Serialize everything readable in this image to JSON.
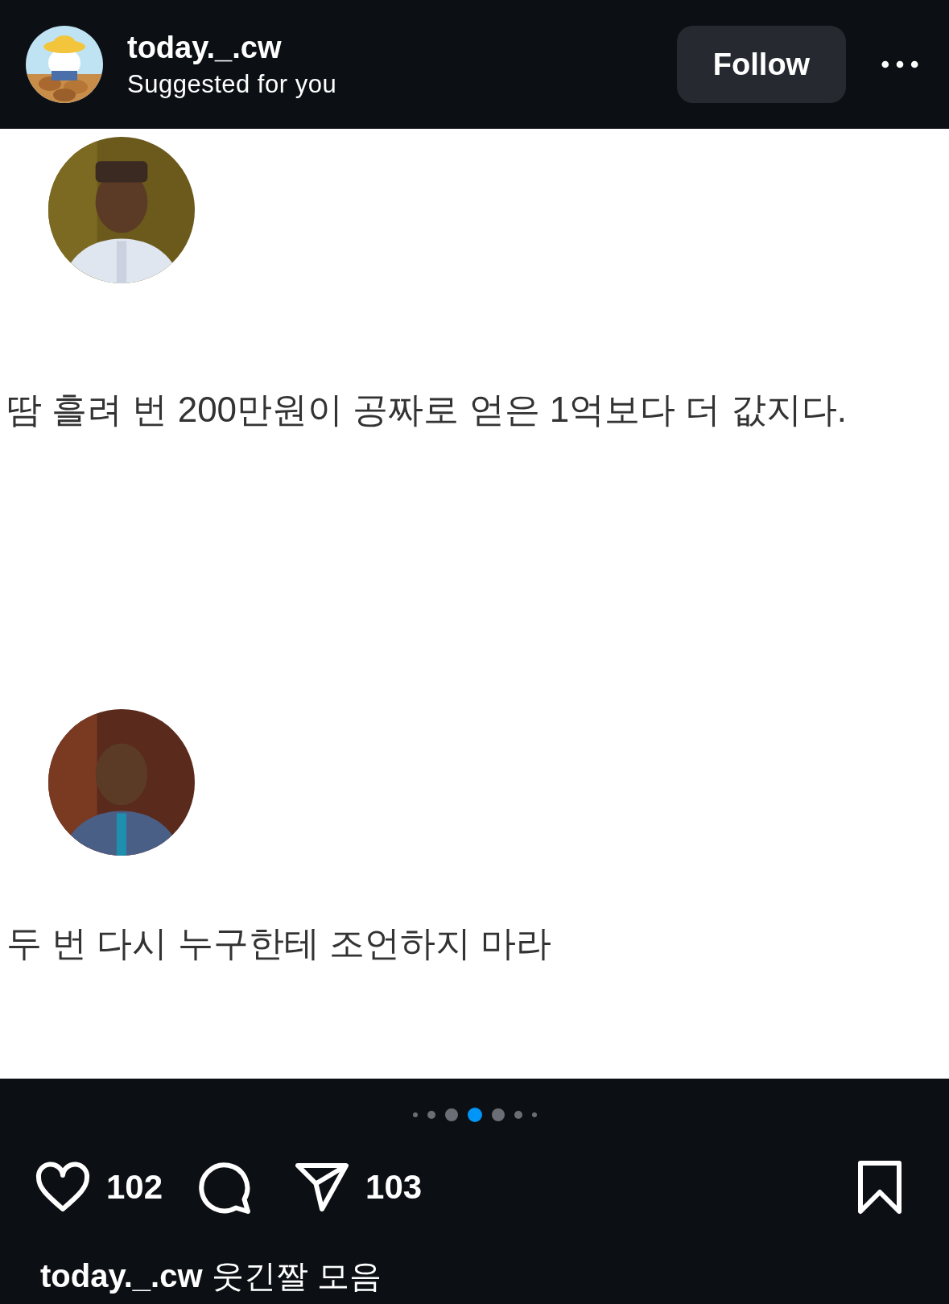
{
  "header": {
    "username": "today._.cw",
    "subtitle": "Suggested for you",
    "follow_button": "Follow"
  },
  "post": {
    "tweets": [
      {
        "text": "땀 흘려 번 200만원이 공짜로 얻은 1억보다 더 값지다."
      },
      {
        "text": "두 번 다시 누구한테 조언하지 마라"
      }
    ]
  },
  "carousel": [
    {
      "selected": false
    },
    {
      "selected": false
    },
    {
      "selected": false
    },
    {
      "selected": true
    },
    {
      "selected": false
    },
    {
      "selected": false
    },
    {
      "selected": false
    }
  ],
  "actions": {
    "likes": "102",
    "shares": "103"
  },
  "caption": {
    "username": "today._.cw",
    "text": "웃긴짤 모음"
  }
}
